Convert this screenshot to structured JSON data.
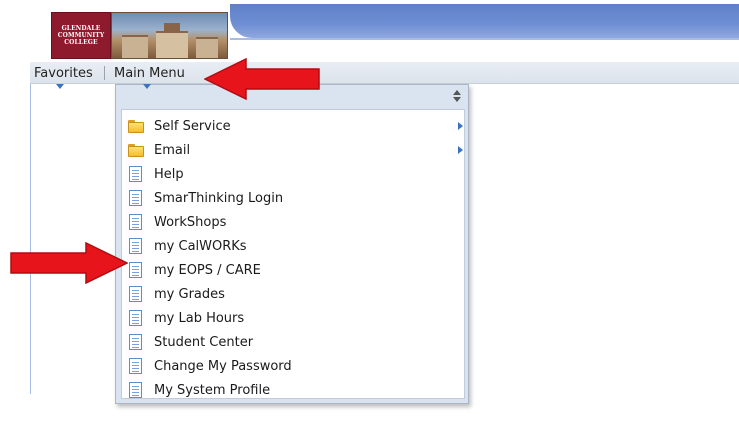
{
  "header": {
    "logo_lines": [
      "GLENDALE",
      "COMMUNITY",
      "COLLEGE"
    ]
  },
  "menubar": {
    "favorites_label": "Favorites",
    "main_menu_label": "Main Menu"
  },
  "dropdown": {
    "items": [
      {
        "label": "Self Service",
        "icon": "folder-icon",
        "has_submenu": true
      },
      {
        "label": "Email",
        "icon": "folder-icon",
        "has_submenu": true
      },
      {
        "label": "Help",
        "icon": "document-icon",
        "has_submenu": false
      },
      {
        "label": "SmarThinking Login",
        "icon": "document-icon",
        "has_submenu": false
      },
      {
        "label": "WorkShops",
        "icon": "document-icon",
        "has_submenu": false
      },
      {
        "label": "my CalWORKs",
        "icon": "document-icon",
        "has_submenu": false
      },
      {
        "label": "my EOPS / CARE",
        "icon": "document-icon",
        "has_submenu": false
      },
      {
        "label": "my Grades",
        "icon": "document-icon",
        "has_submenu": false
      },
      {
        "label": "my Lab Hours",
        "icon": "document-icon",
        "has_submenu": false
      },
      {
        "label": "Student Center",
        "icon": "document-icon",
        "has_submenu": false
      },
      {
        "label": "Change My Password",
        "icon": "document-icon",
        "has_submenu": false
      },
      {
        "label": "My System Profile",
        "icon": "document-icon",
        "has_submenu": false
      }
    ]
  },
  "colors": {
    "banner": "#6f8fd4",
    "logo_bg": "#8e1a2e",
    "annotation_arrow": "#e8141b",
    "menu_caret": "#3a73c4"
  }
}
